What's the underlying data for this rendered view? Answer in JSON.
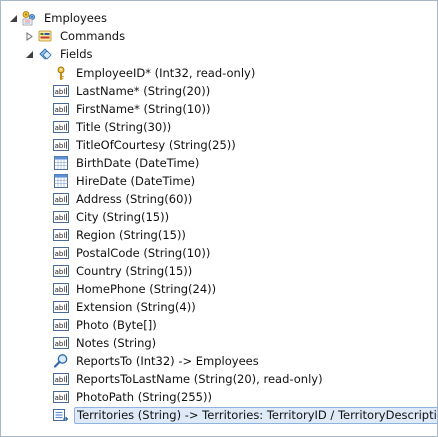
{
  "tree": {
    "root": {
      "label": "Employees",
      "icon": "controller-icon",
      "expanded": true
    },
    "commands": {
      "label": "Commands",
      "icon": "commands-icon",
      "expanded": false
    },
    "fields_node": {
      "label": "Fields",
      "icon": "fields-icon",
      "expanded": true
    },
    "fields": [
      {
        "label": "EmployeeID* (Int32, read-only)",
        "icon": "key-icon"
      },
      {
        "label": "LastName* (String(20))",
        "icon": "text-field-icon"
      },
      {
        "label": "FirstName* (String(10))",
        "icon": "text-field-icon"
      },
      {
        "label": "Title (String(30))",
        "icon": "text-field-icon"
      },
      {
        "label": "TitleOfCourtesy (String(25))",
        "icon": "text-field-icon"
      },
      {
        "label": "BirthDate (DateTime)",
        "icon": "calendar-icon"
      },
      {
        "label": "HireDate (DateTime)",
        "icon": "calendar-icon"
      },
      {
        "label": "Address (String(60))",
        "icon": "text-field-icon"
      },
      {
        "label": "City (String(15))",
        "icon": "text-field-icon"
      },
      {
        "label": "Region (String(15))",
        "icon": "text-field-icon"
      },
      {
        "label": "PostalCode (String(10))",
        "icon": "text-field-icon"
      },
      {
        "label": "Country (String(15))",
        "icon": "text-field-icon"
      },
      {
        "label": "HomePhone (String(24))",
        "icon": "text-field-icon"
      },
      {
        "label": "Extension (String(4))",
        "icon": "text-field-icon"
      },
      {
        "label": "Photo (Byte[])",
        "icon": "text-field-icon"
      },
      {
        "label": "Notes (String)",
        "icon": "text-field-icon"
      },
      {
        "label": "ReportsTo (Int32) -> Employees",
        "icon": "lookup-icon"
      },
      {
        "label": "ReportsToLastName (String(20), read-only)",
        "icon": "text-field-icon"
      },
      {
        "label": "PhotoPath (String(255))",
        "icon": "text-field-icon"
      },
      {
        "label": "Territories (String) -> Territories: TerritoryID / TerritoryDescription",
        "icon": "many-to-many-icon",
        "selected": true
      }
    ]
  }
}
